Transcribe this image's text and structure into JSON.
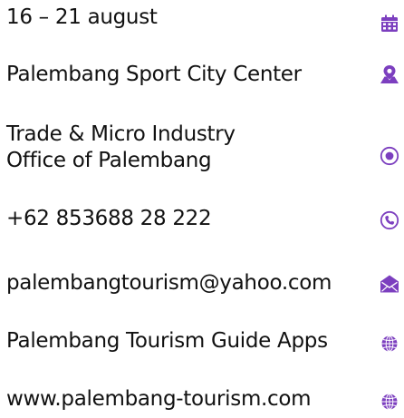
{
  "accent_color": "#7c3fbf",
  "items": [
    {
      "icon": "calendar-icon",
      "lines": [
        "16 – 21 august"
      ]
    },
    {
      "icon": "map-pin-icon",
      "lines": [
        "Palembang Sport City Center"
      ]
    },
    {
      "icon": "radio-target-icon",
      "lines": [
        "Trade & Micro Industry",
        "Office of Palembang"
      ]
    },
    {
      "icon": "phone-icon",
      "lines": [
        "+62 853688 28 222"
      ]
    },
    {
      "icon": "envelope-icon",
      "lines": [
        "palembangtourism@yahoo.com"
      ]
    },
    {
      "icon": "globe-icon",
      "lines": [
        "Palembang Tourism Guide Apps"
      ]
    },
    {
      "icon": "globe-icon",
      "lines": [
        "www.palembang-tourism.com"
      ]
    }
  ]
}
